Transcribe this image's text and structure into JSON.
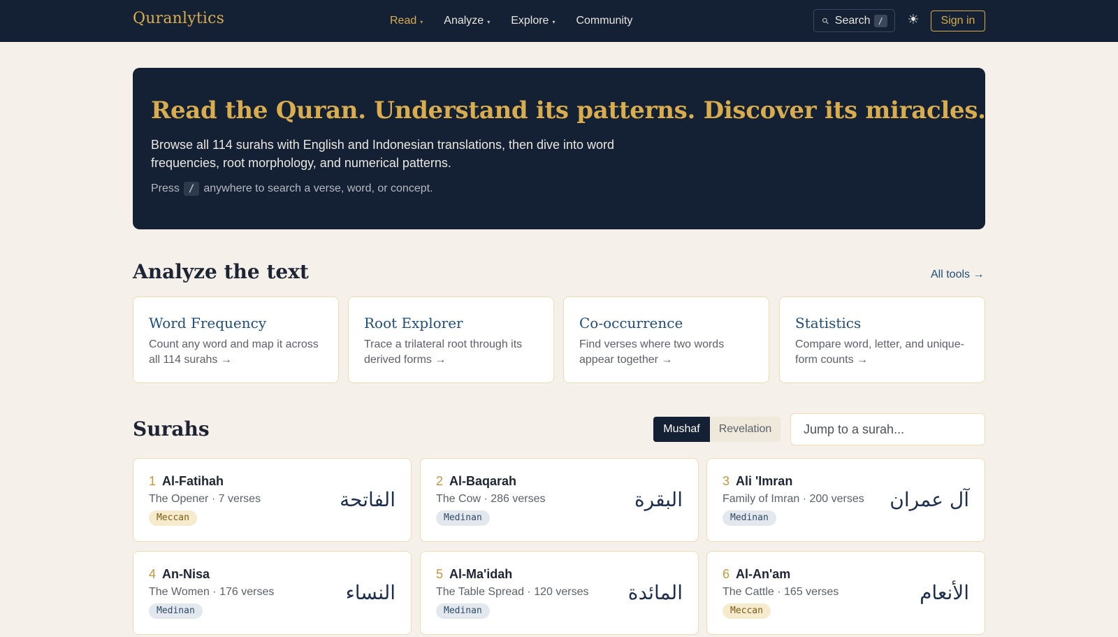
{
  "brand": "Quranlytics",
  "nav": [
    {
      "label": "Read",
      "caret": "▾"
    },
    {
      "label": "Analyze",
      "caret": "▾"
    },
    {
      "label": "Explore",
      "caret": "▾"
    },
    {
      "label": "Community"
    }
  ],
  "header": {
    "search_label": "Search",
    "search_key": "/",
    "sign_in": "Sign in"
  },
  "hero": {
    "title": "Read the Quran. Understand its patterns. Discover its miracles.",
    "description": "Browse all 114 surahs with English and Indonesian translations, then dive into word frequencies, root morphology, and numerical patterns.",
    "hint_prefix": "Press",
    "hint_key": "/",
    "hint_suffix": "anywhere to search a verse, word, or concept."
  },
  "analyze": {
    "title": "Analyze the text",
    "all_tools": "All tools →",
    "tools": [
      {
        "title": "Word Frequency",
        "desc": "Count any word and map it across all 114 surahs →"
      },
      {
        "title": "Root Explorer",
        "desc": "Trace a trilateral root through its derived forms →"
      },
      {
        "title": "Co-occurrence",
        "desc": "Find verses where two words appear together →"
      },
      {
        "title": "Statistics",
        "desc": "Compare word, letter, and unique-form counts →"
      }
    ]
  },
  "surahs": {
    "title": "Surahs",
    "order_options": [
      "Mushaf",
      "Revelation"
    ],
    "selected_order": "Mushaf",
    "jump_placeholder": "Jump to a surah...",
    "items": [
      {
        "number": "1",
        "name": "Al-Fatihah",
        "meta": "The Opener · 7 verses",
        "type": "Meccan",
        "arabic": "الفاتحة"
      },
      {
        "number": "2",
        "name": "Al-Baqarah",
        "meta": "The Cow · 286 verses",
        "type": "Medinan",
        "arabic": "البقرة"
      },
      {
        "number": "3",
        "name": "Ali 'Imran",
        "meta": "Family of Imran · 200 verses",
        "type": "Medinan",
        "arabic": "آل عمران"
      },
      {
        "number": "4",
        "name": "An-Nisa",
        "meta": "The Women · 176 verses",
        "type": "Medinan",
        "arabic": "النساء"
      },
      {
        "number": "5",
        "name": "Al-Ma'idah",
        "meta": "The Table Spread · 120 verses",
        "type": "Medinan",
        "arabic": "المائدة"
      },
      {
        "number": "6",
        "name": "Al-An'am",
        "meta": "The Cattle · 165 verses",
        "type": "Meccan",
        "arabic": "الأنعام"
      }
    ]
  },
  "colors": {
    "navy": "#142033",
    "gold": "#d9ad4e",
    "page_bg": "#f5f1ea",
    "link_blue": "#1f4d7a",
    "meccan_badge": "#f6ebcc",
    "medinan_badge": "#e3e8ee"
  },
  "icons": {
    "search": "search-icon",
    "theme": "sun-icon",
    "dropdown": "chevron-down-icon"
  }
}
